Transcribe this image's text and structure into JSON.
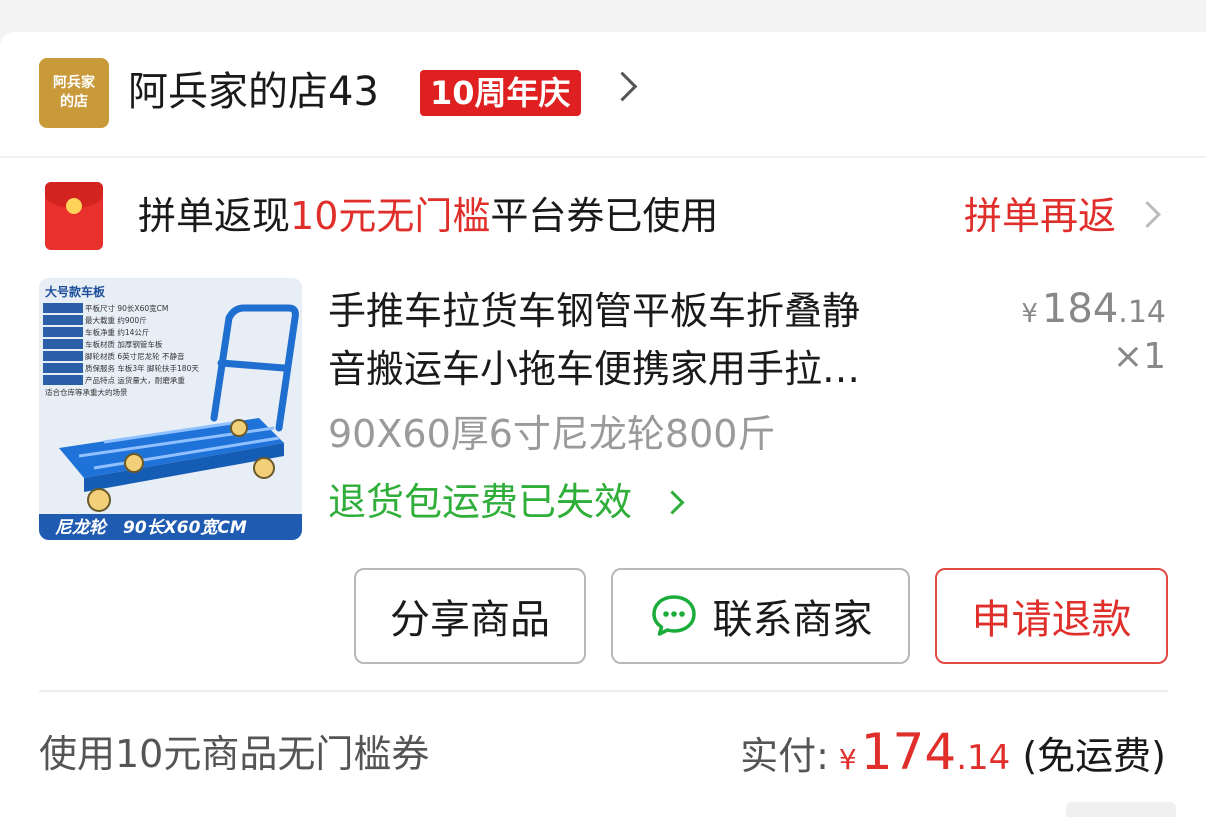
{
  "shop": {
    "logo_line1": "阿兵家",
    "logo_line2": "的店",
    "name": "阿兵家的店43",
    "badge": "10周年庆"
  },
  "promo": {
    "prefix": "拼单返现",
    "highlight": "10元无门槛",
    "suffix": "平台券已使用",
    "action": "拼单再返"
  },
  "product": {
    "image_tag": "大号款车板",
    "image_caption": "尼龙轮　90长X60宽CM",
    "image_specs": [
      "平板尺寸  90长X60宽CM",
      "最大载重  约900斤",
      "车板净重  约14公斤",
      "车板材质  加厚钢管车板",
      "脚轮材质  6英寸尼龙轮 不静音",
      "质保服务  车板3年 脚轮扶手180天",
      "产品特点  运货量大，耐磨承重",
      "适合仓库等承重大的场景"
    ],
    "title_line1": "手推车拉货车钢管平板车折叠静",
    "title_line2": "音搬运车小拖车便携家用手拉…",
    "price_currency": "¥",
    "price_int": "184",
    "price_dec": ".14",
    "quantity": "×1",
    "spec": "90X60厚6寸尼龙轮800斤",
    "return_note": "退货包运费已失效"
  },
  "actions": {
    "share": "分享商品",
    "contact": "联系商家",
    "refund": "申请退款"
  },
  "summary": {
    "coupon": "使用10元商品无门槛券",
    "paid_label": "实付:",
    "currency": "¥",
    "amount_int": "174",
    "amount_dec": ".14",
    "shipping": " (免运费)"
  }
}
